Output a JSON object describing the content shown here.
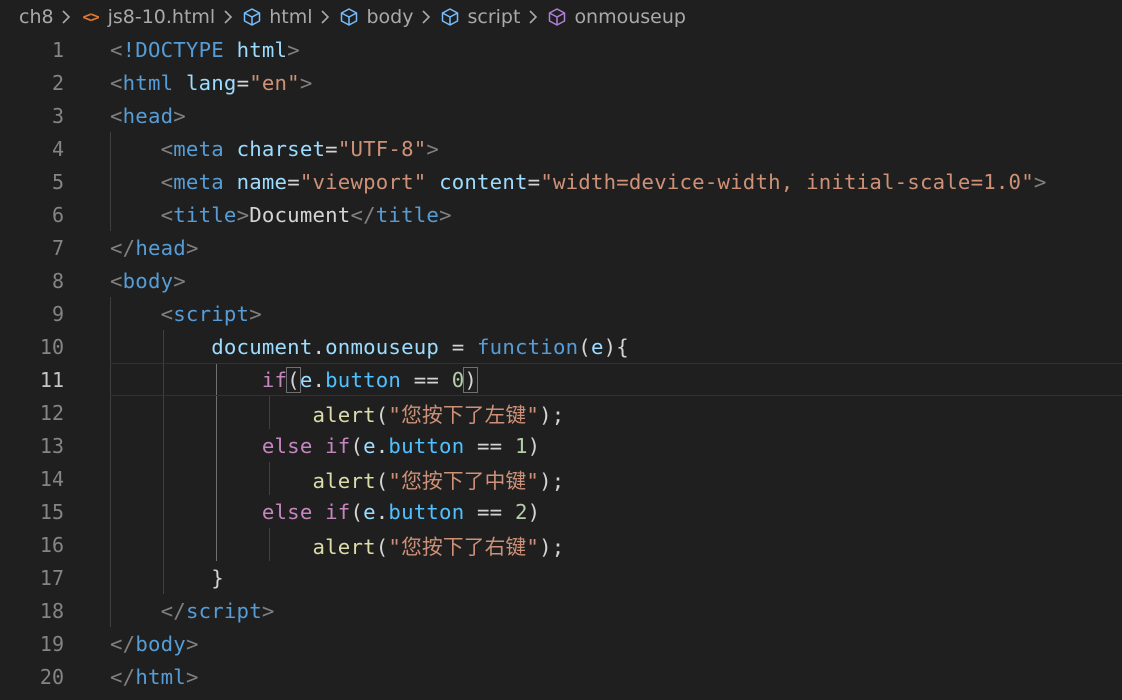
{
  "breadcrumb": {
    "items": [
      {
        "label": "ch8",
        "icon": "none"
      },
      {
        "label": "js8-10.html",
        "icon": "html-file-icon"
      },
      {
        "label": "html",
        "icon": "cube-icon"
      },
      {
        "label": "body",
        "icon": "cube-icon"
      },
      {
        "label": "script",
        "icon": "cube-icon"
      },
      {
        "label": "onmouseup",
        "icon": "method-cube-icon"
      }
    ]
  },
  "editor": {
    "current_line": 11,
    "lines": [
      {
        "n": "1"
      },
      {
        "n": "2"
      },
      {
        "n": "3"
      },
      {
        "n": "4"
      },
      {
        "n": "5"
      },
      {
        "n": "6"
      },
      {
        "n": "7"
      },
      {
        "n": "8"
      },
      {
        "n": "9"
      },
      {
        "n": "10"
      },
      {
        "n": "11"
      },
      {
        "n": "12"
      },
      {
        "n": "13"
      },
      {
        "n": "14"
      },
      {
        "n": "15"
      },
      {
        "n": "16"
      },
      {
        "n": "17"
      },
      {
        "n": "18"
      },
      {
        "n": "19"
      },
      {
        "n": "20"
      }
    ],
    "tokens": {
      "lt": "<",
      "gt": ">",
      "lt_slash": "</",
      "eq": "=",
      "doctype": "!DOCTYPE",
      "html": "html",
      "lang": "lang",
      "en": "\"en\"",
      "head": "head",
      "meta": "meta",
      "charset": "charset",
      "utf8": "\"UTF-8\"",
      "name": "name",
      "viewport": "\"viewport\"",
      "content": "content",
      "content_val": "\"width=device-width, initial-scale=1.0\"",
      "title": "title",
      "document_text": "Document",
      "body": "body",
      "script": "script",
      "document": "document",
      "dot": ".",
      "onmouseup": "onmouseup",
      "assign": " = ",
      "function": "function",
      "paren_open": "(",
      "paren_close": ")",
      "e": "e",
      "brace_open": "{",
      "brace_close": "}",
      "if": "if",
      "else": "else",
      "button": "button",
      "eqeq": " == ",
      "zero": "0",
      "one": "1",
      "two": "2",
      "alert": "alert",
      "semi": ";",
      "msg_left": "\"您按下了左键\"",
      "msg_middle": "\"您按下了中键\"",
      "msg_right": "\"您按下了右键\""
    }
  }
}
